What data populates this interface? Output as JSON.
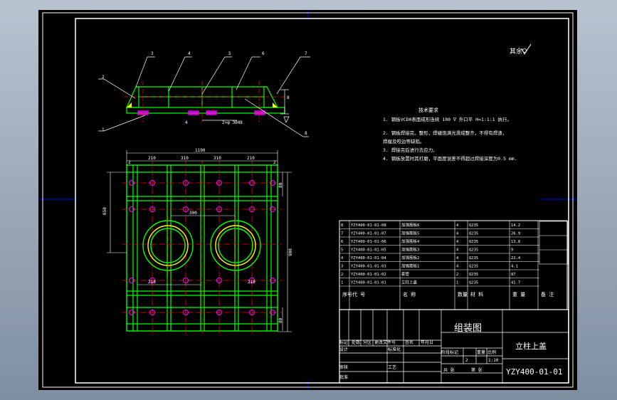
{
  "viewport": {
    "background": "#8e9cae",
    "sheet_color": "#000000"
  },
  "colors": {
    "frame": "#ffffff",
    "outline": "#00ff00",
    "hole": "#ff00ff",
    "center": "#ff0000",
    "dim": "#ffffff",
    "fill": "#ffff00",
    "border_mark": "#0000ff"
  },
  "roughness": {
    "label": "其余",
    "symbol": "roughness-icon"
  },
  "tech_requirements": {
    "title": "技术要求",
    "lines": [
      "1. 钢板VCD0表面成形连续 100 ∇ 外口平 H=1:1:1 执行。",
      "2. 钢板焊接完，整形，焊缝饱满光滑成整齐，不得有焊渣，",
      "焊瘤及咬边等缺陷。",
      "3. 焊接完后进行去应力。",
      "4. 钢板放置时其打磨，平面度误差不得超过焊接深度为0.5 mm."
    ]
  },
  "top_view": {
    "leaders": [
      "1",
      "2",
      "3",
      "4",
      "5",
      "6",
      "7",
      "8"
    ],
    "dims": {
      "height": "8",
      "center": "2×φ 30H8",
      "weld": "4"
    }
  },
  "plan_view": {
    "dims": {
      "overall_width": "1190",
      "seg1": "210",
      "seg2": "310",
      "seg3": "310",
      "seg4": "210",
      "edge_left": "2",
      "edge_right": "2",
      "inner": "300",
      "left_height": "650",
      "right_height": "900",
      "right_top": "80",
      "right_bottom": "80",
      "bottom_seg1": "210",
      "bottom_seg2": "210"
    }
  },
  "bom": {
    "rows": [
      {
        "no": "8",
        "code": "YZY400-01-01-08",
        "name": "加强筋板6",
        "qty": "4",
        "material": "Q235",
        "weight": "14.2",
        "remark": ""
      },
      {
        "no": "7",
        "code": "YZY400-01-01-07",
        "name": "加强筋板5",
        "qty": "4",
        "material": "Q235",
        "weight": "26.9",
        "remark": ""
      },
      {
        "no": "6",
        "code": "YZY400-01-01-06",
        "name": "加强筋板4",
        "qty": "4",
        "material": "Q235",
        "weight": "13.8",
        "remark": ""
      },
      {
        "no": "5",
        "code": "YZY400-01-01-05",
        "name": "加强筋板3",
        "qty": "4",
        "material": "Q235",
        "weight": "9",
        "remark": ""
      },
      {
        "no": "4",
        "code": "YZY400-01-01-04",
        "name": "加强筋板2",
        "qty": "4",
        "material": "Q235",
        "weight": "22.4",
        "remark": ""
      },
      {
        "no": "3",
        "code": "YZY400-01-01-03",
        "name": "加强筋板1",
        "qty": "4",
        "material": "Q235",
        "weight": "4.1",
        "remark": ""
      },
      {
        "no": "2",
        "code": "YZY400-01-01-02",
        "name": "套管",
        "qty": "2",
        "material": "Q235",
        "weight": "87",
        "remark": ""
      },
      {
        "no": "1",
        "code": "YZY400-01-01-01",
        "name": "立柱上盖",
        "qty": "1",
        "material": "Q235",
        "weight": "41.7",
        "remark": ""
      }
    ],
    "header": {
      "no": "序号",
      "code": "代 号",
      "name": "名 称",
      "qty": "数量",
      "material": "材 料",
      "weight": "重 量",
      "remark": "备 注"
    }
  },
  "title_block": {
    "drawing_type": "组装图",
    "part_name": "立柱上盖",
    "drawing_no": "YZY400-01-01",
    "scale_label": "比例",
    "scale": "1:10",
    "qty": "2",
    "labels": [
      "标记",
      "处数",
      "分区",
      "更改文件号",
      "签名",
      "年月日",
      "设计",
      "标准化",
      "审核",
      "工艺",
      "批准",
      "阶段标记",
      "重量",
      "共 张",
      "第 张"
    ]
  }
}
